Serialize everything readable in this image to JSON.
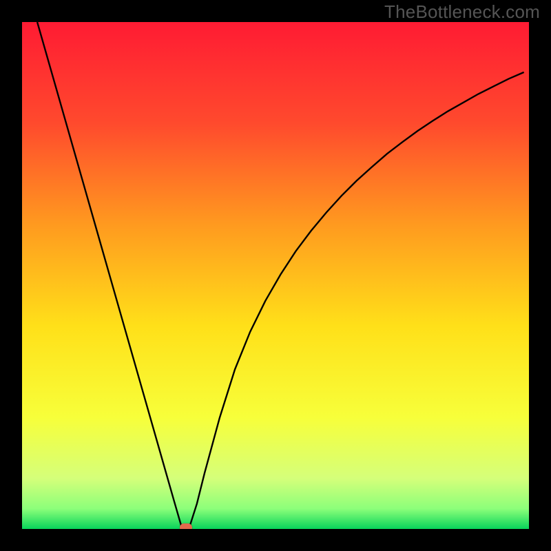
{
  "watermark": "TheBottleneck.com",
  "chart_data": {
    "type": "line",
    "title": "",
    "xlabel": "",
    "ylabel": "",
    "xlim": [
      0,
      100
    ],
    "ylim": [
      0,
      100
    ],
    "x": [
      3,
      6,
      9,
      12,
      15,
      18,
      21,
      24,
      27,
      30,
      31.5,
      33,
      34.5,
      36,
      39,
      42,
      45,
      48,
      51,
      54,
      57,
      60,
      63,
      66,
      69,
      72,
      75,
      78,
      81,
      84,
      87,
      90,
      93,
      96,
      99
    ],
    "values": [
      100,
      89.5,
      79,
      68.5,
      58,
      47.5,
      37,
      26.5,
      16,
      5.5,
      0.3,
      0.3,
      5,
      11,
      22,
      31.5,
      38.9,
      45,
      50.2,
      54.8,
      58.8,
      62.4,
      65.7,
      68.7,
      71.4,
      74.0,
      76.3,
      78.5,
      80.5,
      82.4,
      84.1,
      85.8,
      87.3,
      88.8,
      90.1
    ],
    "marker": {
      "x": 32.3,
      "y": 0.3,
      "color": "#e26a4d"
    },
    "gradient_stops": [
      {
        "offset": 0,
        "color": "#ff1b33"
      },
      {
        "offset": 20,
        "color": "#ff4a2d"
      },
      {
        "offset": 40,
        "color": "#ff9a1f"
      },
      {
        "offset": 60,
        "color": "#ffe019"
      },
      {
        "offset": 78,
        "color": "#f7ff3a"
      },
      {
        "offset": 90,
        "color": "#d5ff7a"
      },
      {
        "offset": 96,
        "color": "#8cff7a"
      },
      {
        "offset": 100,
        "color": "#08d45a"
      }
    ]
  }
}
